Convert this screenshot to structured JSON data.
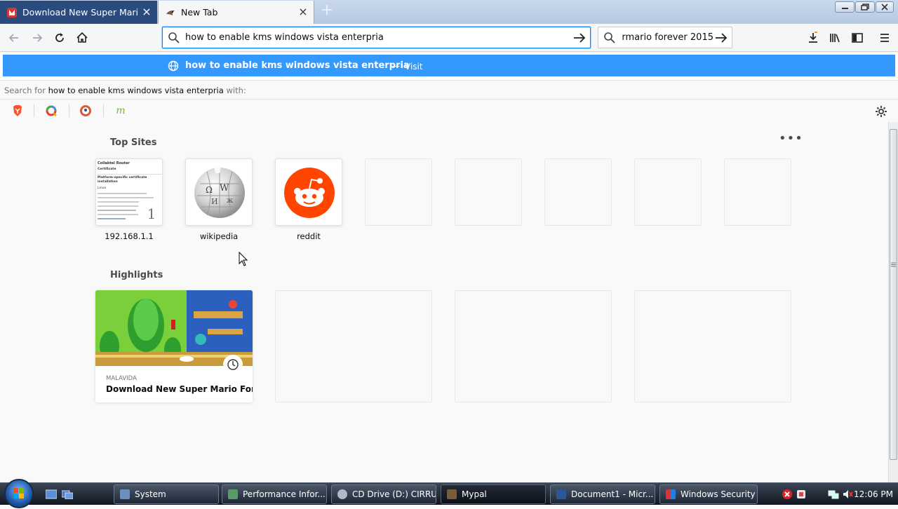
{
  "browser": {
    "tabs": [
      {
        "title": "Download New Super Mario Fo",
        "active": false
      },
      {
        "title": "New Tab",
        "active": true
      }
    ],
    "url_input": "how to enable kms windows vista enterpria",
    "search_input": "e rmario forever 2015"
  },
  "dropdown": {
    "suggestion_title": "how to enable kms windows vista enterpria",
    "suggestion_separator": "—",
    "suggestion_action": "Visit",
    "search_for_prefix": "Search for",
    "search_for_query": "how to enable kms windows vista enterpria",
    "search_for_suffix": "with:",
    "engines": [
      "brave-icon",
      "qwant-icon",
      "duckduckgo-icon",
      "mojeek-icon"
    ]
  },
  "newtab": {
    "top_sites_heading": "Top Sites",
    "top_sites": [
      {
        "label": "192.168.1.1",
        "pin": "1"
      },
      {
        "label": "wikipedia"
      },
      {
        "label": "reddit"
      }
    ],
    "highlights_heading": "Highlights",
    "highlight": {
      "source": "MALAVIDA",
      "title": "Download New Super Mario For..."
    },
    "router_preview_lines": [
      "Collabtel Router",
      "Certificate",
      "Platform-specific certificate installation",
      "Linux"
    ]
  },
  "taskbar": {
    "items": [
      "System",
      "Performance Infor...",
      "CD Drive (D:) CIRRUS",
      "Mypal",
      "Document1 - Micr...",
      "Windows Security ..."
    ],
    "time": "12:06 PM"
  },
  "colors": {
    "accent": "#0a84ff",
    "suggestion_bg": "#3399ff",
    "reddit": "#ff4500"
  }
}
